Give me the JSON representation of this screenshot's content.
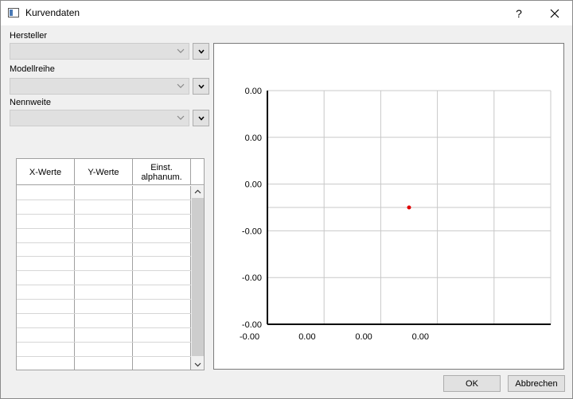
{
  "window": {
    "title": "Kurvendaten",
    "help_label": "?"
  },
  "filters": {
    "hersteller_label": "Hersteller",
    "modellreihe_label": "Modellreihe",
    "nennweite_label": "Nennweite",
    "hersteller_value": "",
    "modellreihe_value": "",
    "nennweite_value": ""
  },
  "table": {
    "columns": [
      "X-Werte",
      "Y-Werte",
      "Einst.\nalphanum."
    ],
    "row_count": 13
  },
  "chart_data": {
    "type": "scatter",
    "title": "",
    "xlabel": "",
    "ylabel": "",
    "x_tick_labels": [
      "-0.00",
      "0.00",
      "0.00",
      "0.00"
    ],
    "y_tick_labels": [
      "0.00",
      "0.00",
      "0.00",
      "-0.00",
      "-0.00",
      "-0.00"
    ],
    "xlim": [
      -0.001,
      0.004
    ],
    "ylim": [
      -0.001,
      0.004
    ],
    "grid": true,
    "series": [
      {
        "x": [
          0.0015
        ],
        "y": [
          0.0015
        ],
        "color": "#e00000"
      }
    ]
  },
  "buttons": {
    "ok": "OK",
    "cancel": "Abbrechen"
  }
}
